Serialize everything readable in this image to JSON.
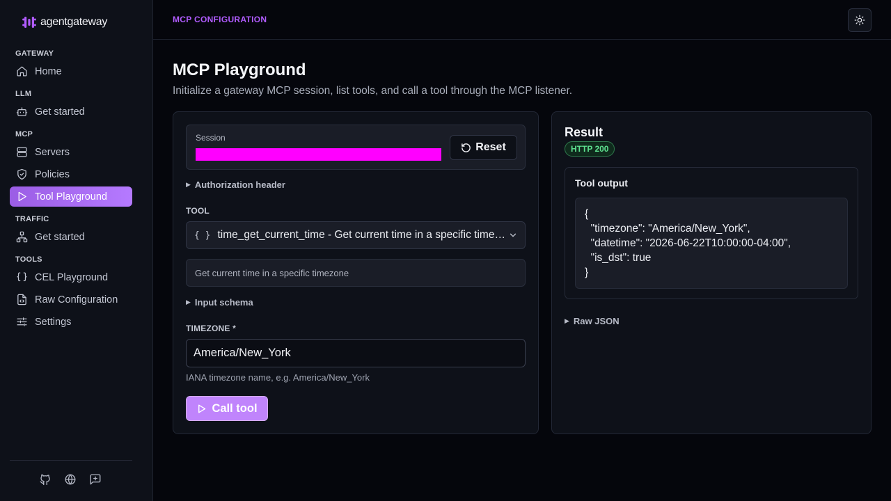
{
  "brand": {
    "name": "agentgateway"
  },
  "sidebar": {
    "sections": [
      {
        "label": "GATEWAY",
        "items": [
          {
            "label": "Home",
            "icon": "home-icon"
          }
        ]
      },
      {
        "label": "LLM",
        "items": [
          {
            "label": "Get started",
            "icon": "robot-icon"
          }
        ]
      },
      {
        "label": "MCP",
        "items": [
          {
            "label": "Servers",
            "icon": "server-icon"
          },
          {
            "label": "Policies",
            "icon": "shield-icon"
          },
          {
            "label": "Tool Playground",
            "icon": "play-icon",
            "active": true
          }
        ]
      },
      {
        "label": "TRAFFIC",
        "items": [
          {
            "label": "Get started",
            "icon": "network-icon"
          }
        ]
      },
      {
        "label": "TOOLS",
        "items": [
          {
            "label": "CEL Playground",
            "icon": "braces-icon"
          },
          {
            "label": "Raw Configuration",
            "icon": "file-code-icon"
          },
          {
            "label": "Settings",
            "icon": "sliders-icon"
          }
        ]
      }
    ],
    "footer_icons": [
      "github-icon",
      "globe-icon",
      "feedback-icon"
    ]
  },
  "topbar": {
    "breadcrumb": "MCP CONFIGURATION",
    "theme_icon": "sun-icon"
  },
  "page": {
    "title": "MCP Playground",
    "subtitle": "Initialize a gateway MCP session, list tools, and call a tool through the MCP listener."
  },
  "form": {
    "session_label": "Session",
    "reset_label": "Reset",
    "auth_header_label": "Authorization header",
    "tool_label": "TOOL",
    "tool_selected": "time_get_current_time - Get current time in a specific timezone",
    "tool_description": "Get current time in a specific timezone",
    "input_schema_label": "Input schema",
    "timezone_label": "TIMEZONE *",
    "timezone_value": "America/New_York",
    "timezone_hint": "IANA timezone name, e.g. America/New_York",
    "call_label": "Call tool"
  },
  "result": {
    "title": "Result",
    "status": "HTTP 200",
    "output_title": "Tool output",
    "output_code": "{\n  \"timezone\": \"America/New_York\",\n  \"datetime\": \"2026-06-22T10:00:00-04:00\",\n  \"is_dst\": true\n}",
    "raw_json_label": "Raw JSON"
  },
  "colors": {
    "accent": "#b15cff",
    "active_nav": "#a569f0",
    "call_button": "#c084fc",
    "session_redaction": "#ff00ff",
    "status_green": "#5ee08f"
  }
}
